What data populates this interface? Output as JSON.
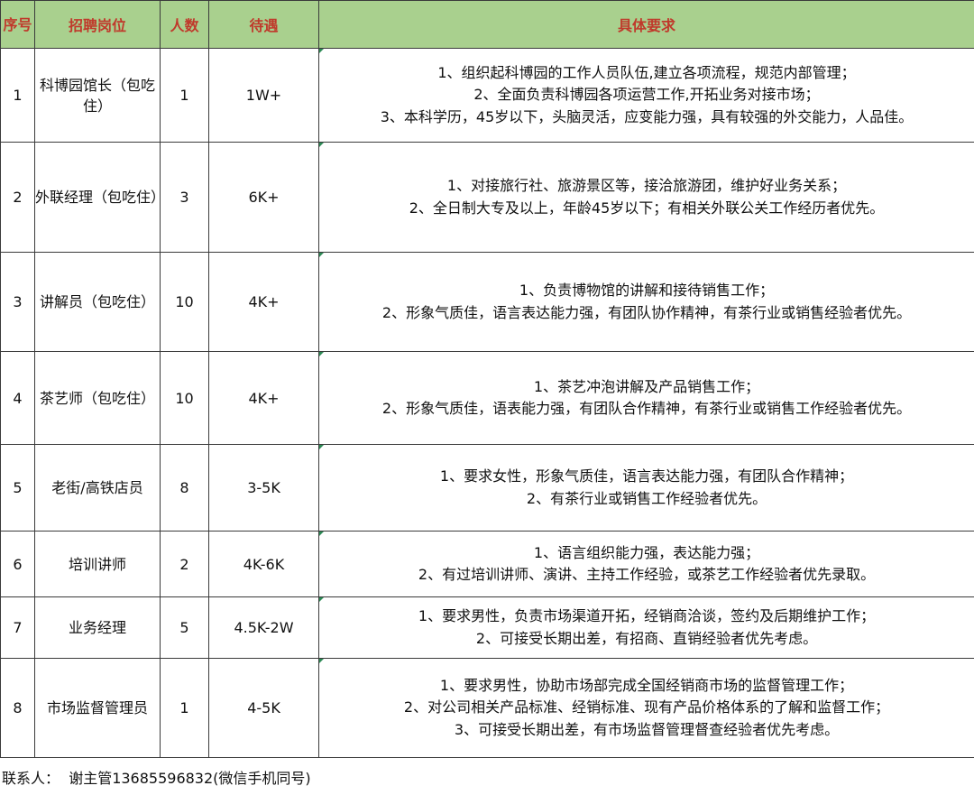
{
  "headers": {
    "seq": "序号",
    "position": "招聘岗位",
    "count": "人数",
    "salary": "待遇",
    "requirements": "具体要求"
  },
  "rows": [
    {
      "seq": "1",
      "position": "科博园馆长（包吃住）",
      "count": "1",
      "salary": "1W+",
      "requirements": [
        "1、组织起科博园的工作人员队伍,建立各项流程，规范内部管理；",
        "2、全面负责科博园各项运营工作,开拓业务对接市场；",
        "3、本科学历，45岁以下，头脑灵活，应变能力强，具有较强的外交能力，人品佳。"
      ]
    },
    {
      "seq": "2",
      "position": "外联经理（包吃住）",
      "count": "3",
      "salary": "6K+",
      "requirements": [
        "1、对接旅行社、旅游景区等，接洽旅游团，维护好业务关系；",
        "2、全日制大专及以上，年龄45岁以下；有相关外联公关工作经历者优先。"
      ]
    },
    {
      "seq": "3",
      "position": "讲解员（包吃住）",
      "count": "10",
      "salary": "4K+",
      "requirements": [
        "1、负责博物馆的讲解和接待销售工作；",
        "2、形象气质佳，语言表达能力强，有团队协作精神，有茶行业或销售经验者优先。"
      ]
    },
    {
      "seq": "4",
      "position": "茶艺师（包吃住）",
      "count": "10",
      "salary": "4K+",
      "requirements": [
        "1、茶艺冲泡讲解及产品销售工作；",
        "2、形象气质佳，语表能力强，有团队合作精神，有茶行业或销售工作经验者优先。"
      ]
    },
    {
      "seq": "5",
      "position": "老街/高铁店员",
      "count": "8",
      "salary": "3-5K",
      "requirements": [
        "1、要求女性，形象气质佳，语言表达能力强，有团队合作精神；",
        "2、有茶行业或销售工作经验者优先。"
      ]
    },
    {
      "seq": "6",
      "position": "培训讲师",
      "count": "2",
      "salary": "4K-6K",
      "requirements": [
        "1、语言组织能力强，表达能力强；",
        "2、有过培训讲师、演讲、主持工作经验，或茶艺工作经验者优先录取。"
      ]
    },
    {
      "seq": "7",
      "position": "业务经理",
      "count": "5",
      "salary": "4.5K-2W",
      "requirements": [
        "1、要求男性，负责市场渠道开拓，经销商洽谈，签约及后期维护工作；",
        "2、可接受长期出差，有招商、直销经验者优先考虑。"
      ]
    },
    {
      "seq": "8",
      "position": "市场监督管理员",
      "count": "1",
      "salary": "4-5K",
      "requirements": [
        "1、要求男性，协助市场部完成全国经销商市场的监督管理工作；",
        "2、对公司相关产品标准、经销标准、现有产品价格体系的了解和监督工作；",
        "3、可接受长期出差，有市场监督管理督查经验者优先考虑。"
      ]
    }
  ],
  "contact": {
    "label": "联系人：",
    "value": "谢主管13685596832(微信手机同号)"
  }
}
